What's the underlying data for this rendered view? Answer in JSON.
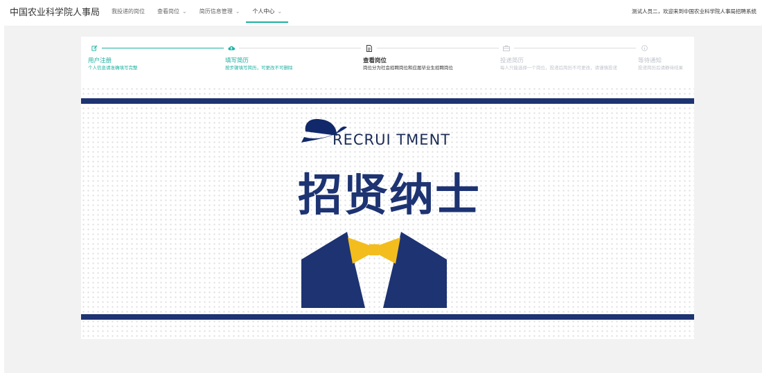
{
  "header": {
    "title": "中国农业科学院人事局",
    "nav": [
      {
        "label": "我投递的岗位",
        "has_caret": false,
        "active": false
      },
      {
        "label": "查看岗位",
        "has_caret": true,
        "active": false
      },
      {
        "label": "简历信息管理",
        "has_caret": true,
        "active": false
      },
      {
        "label": "个人中心",
        "has_caret": true,
        "active": true
      }
    ],
    "welcome": "测试人员二，欢迎来到中国农业科学院人事局招聘系统"
  },
  "steps": [
    {
      "icon": "edit-icon",
      "title": "用户注册",
      "desc": "个人信息请准确填写完整",
      "status": "done"
    },
    {
      "icon": "cloud-upload-icon",
      "title": "填写简历",
      "desc": "按步骤填写简历，可更改不可删除",
      "status": "done"
    },
    {
      "icon": "document-icon",
      "title": "查看岗位",
      "desc": "岗位分为社会招聘岗位和应届毕业生招聘岗位",
      "status": "current"
    },
    {
      "icon": "briefcase-icon",
      "title": "投递简历",
      "desc": "每人只能选择一个岗位，投递后简历不可更改，请谨慎投递",
      "status": "wait"
    },
    {
      "icon": "info-icon",
      "title": "等待通知",
      "desc": "投递简历后请静待结果",
      "status": "wait"
    }
  ],
  "banner": {
    "recruit_text": "RECRUI TMENT",
    "headline": "招贤纳士",
    "colors": {
      "navy": "#1d3372",
      "bowtie": "#f3bd1e",
      "accent": "#1bb0a0"
    }
  }
}
